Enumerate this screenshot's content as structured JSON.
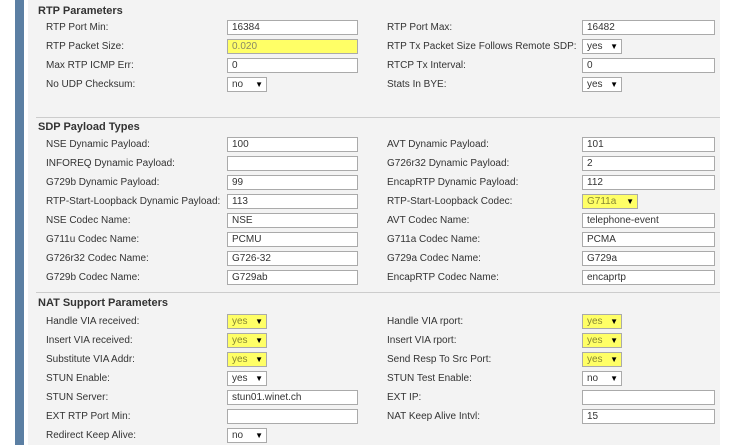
{
  "sections": {
    "rtp": {
      "title": "RTP Parameters",
      "rows": [
        {
          "l_label": "RTP Port Min:",
          "l_value": "16384",
          "r_label": "RTP Port Max:",
          "r_value": "16482"
        },
        {
          "l_label": "RTP Packet Size:",
          "l_value": "0.020",
          "r_label": "RTP Tx Packet Size Follows Remote SDP:",
          "r_value": "yes"
        },
        {
          "l_label": "Max RTP ICMP Err:",
          "l_value": "0",
          "r_label": "RTCP Tx Interval:",
          "r_value": "0"
        },
        {
          "l_label": "No UDP Checksum:",
          "l_value": "no",
          "r_label": "Stats In BYE:",
          "r_value": "yes"
        }
      ]
    },
    "sdp": {
      "title": "SDP Payload Types",
      "rows": [
        {
          "l_label": "NSE Dynamic Payload:",
          "l_value": "100",
          "r_label": "AVT Dynamic Payload:",
          "r_value": "101"
        },
        {
          "l_label": "INFOREQ Dynamic Payload:",
          "l_value": "",
          "r_label": "G726r32 Dynamic Payload:",
          "r_value": "2"
        },
        {
          "l_label": "G729b Dynamic Payload:",
          "l_value": "99",
          "r_label": "EncapRTP Dynamic Payload:",
          "r_value": "112"
        },
        {
          "l_label": "RTP-Start-Loopback Dynamic Payload:",
          "l_value": "113",
          "r_label": "RTP-Start-Loopback Codec:",
          "r_value": "G711a"
        },
        {
          "l_label": "NSE Codec Name:",
          "l_value": "NSE",
          "r_label": "AVT Codec Name:",
          "r_value": "telephone-event"
        },
        {
          "l_label": "G711u Codec Name:",
          "l_value": "PCMU",
          "r_label": "G711a Codec Name:",
          "r_value": "PCMA"
        },
        {
          "l_label": "G726r32 Codec Name:",
          "l_value": "G726-32",
          "r_label": "G729a Codec Name:",
          "r_value": "G729a"
        },
        {
          "l_label": "G729b Codec Name:",
          "l_value": "G729ab",
          "r_label": "EncapRTP Codec Name:",
          "r_value": "encaprtp"
        }
      ]
    },
    "nat": {
      "title": "NAT Support Parameters",
      "rows": [
        {
          "l_label": "Handle VIA received:",
          "l_value": "yes",
          "r_label": "Handle VIA rport:",
          "r_value": "yes"
        },
        {
          "l_label": "Insert VIA received:",
          "l_value": "yes",
          "r_label": "Insert VIA rport:",
          "r_value": "yes"
        },
        {
          "l_label": "Substitute VIA Addr:",
          "l_value": "yes",
          "r_label": "Send Resp To Src Port:",
          "r_value": "yes"
        },
        {
          "l_label": "STUN Enable:",
          "l_value": "yes",
          "r_label": "STUN Test Enable:",
          "r_value": "no"
        },
        {
          "l_label": "STUN Server:",
          "l_value": "stun01.winet.ch",
          "r_label": "EXT IP:",
          "r_value": ""
        },
        {
          "l_label": "EXT RTP Port Min:",
          "l_value": "",
          "r_label": "NAT Keep Alive Intvl:",
          "r_value": "15"
        },
        {
          "l_label": "Redirect Keep Alive:",
          "l_value": "no"
        }
      ]
    }
  },
  "colors": {
    "highlight": "#ffff66",
    "sidebar": "#5b7fa3",
    "panel": "#f3f3f3"
  }
}
